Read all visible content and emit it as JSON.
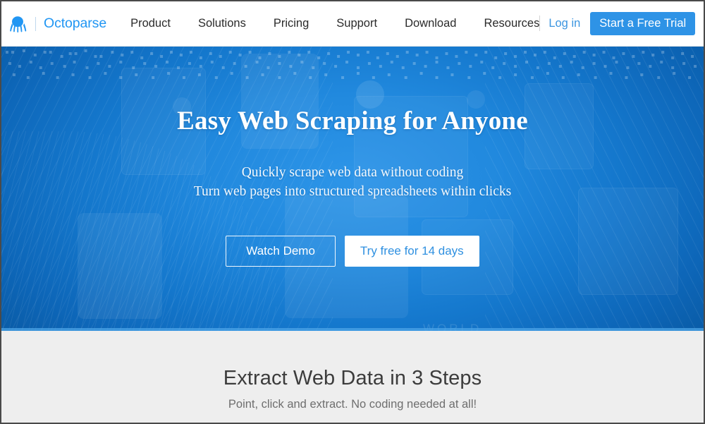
{
  "brand": {
    "logo_icon": "octopus-icon",
    "name": "Octoparse",
    "logo_color": "#2196f3"
  },
  "nav": {
    "links": [
      {
        "label": "Product"
      },
      {
        "label": "Solutions"
      },
      {
        "label": "Pricing"
      },
      {
        "label": "Support"
      },
      {
        "label": "Download"
      },
      {
        "label": "Resources"
      }
    ],
    "login_label": "Log in",
    "cta_label": "Start a Free Trial",
    "cta_color": "#2e93e6"
  },
  "hero": {
    "title": "Easy Web Scraping for Anyone",
    "subtitle_line1": "Quickly scrape web data without coding",
    "subtitle_line2": "Turn web pages into structured spreadsheets within clicks",
    "watch_demo_label": "Watch Demo",
    "try_free_label": "Try free for 14 days",
    "background_color": "#2189de",
    "watermark_text": "WORLD"
  },
  "steps": {
    "title": "Extract Web Data in 3 Steps",
    "subtitle": "Point, click and extract. No coding needed at all!",
    "background_color": "#eeeeee"
  }
}
